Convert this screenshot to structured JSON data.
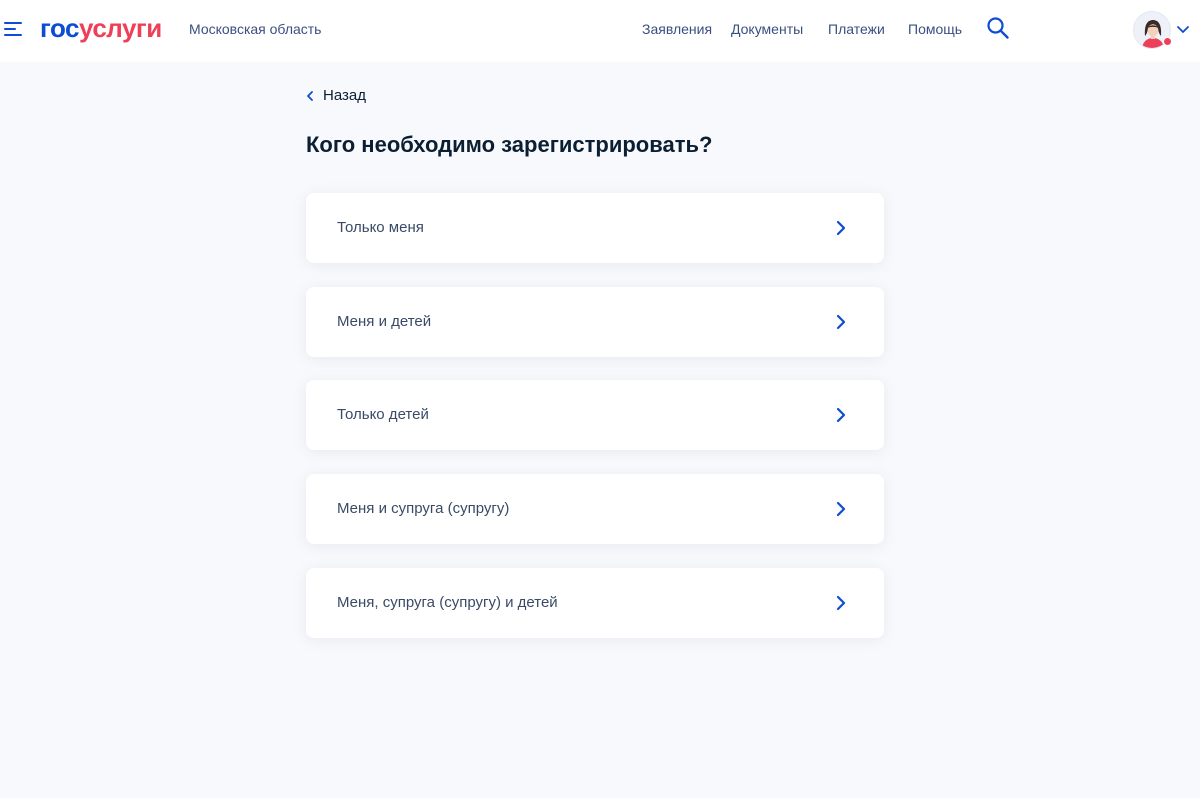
{
  "header": {
    "logo_part1": "гос",
    "logo_part2": "услуги",
    "region": "Московская область",
    "nav": [
      {
        "label": "Заявления"
      },
      {
        "label": "Документы"
      },
      {
        "label": "Платежи"
      },
      {
        "label": "Помощь"
      }
    ],
    "icons": {
      "menu": "menu-icon",
      "search": "search-icon",
      "avatar": "avatar-icon",
      "dropdown": "chevron-down-icon"
    }
  },
  "main": {
    "back_label": "Назад",
    "title": "Кого необходимо зарегистрировать?",
    "options": [
      {
        "label": "Только меня"
      },
      {
        "label": "Меня и детей"
      },
      {
        "label": "Только детей"
      },
      {
        "label": "Меня и супруга (супругу)"
      },
      {
        "label": "Меня, супруга (супругу) и детей"
      }
    ]
  },
  "colors": {
    "brand_blue": "#0d4cd3",
    "brand_red": "#ee3f58",
    "page_bg": "#f8f9fc",
    "text_dark": "#0b1f33",
    "text_muted": "#3a5080"
  }
}
